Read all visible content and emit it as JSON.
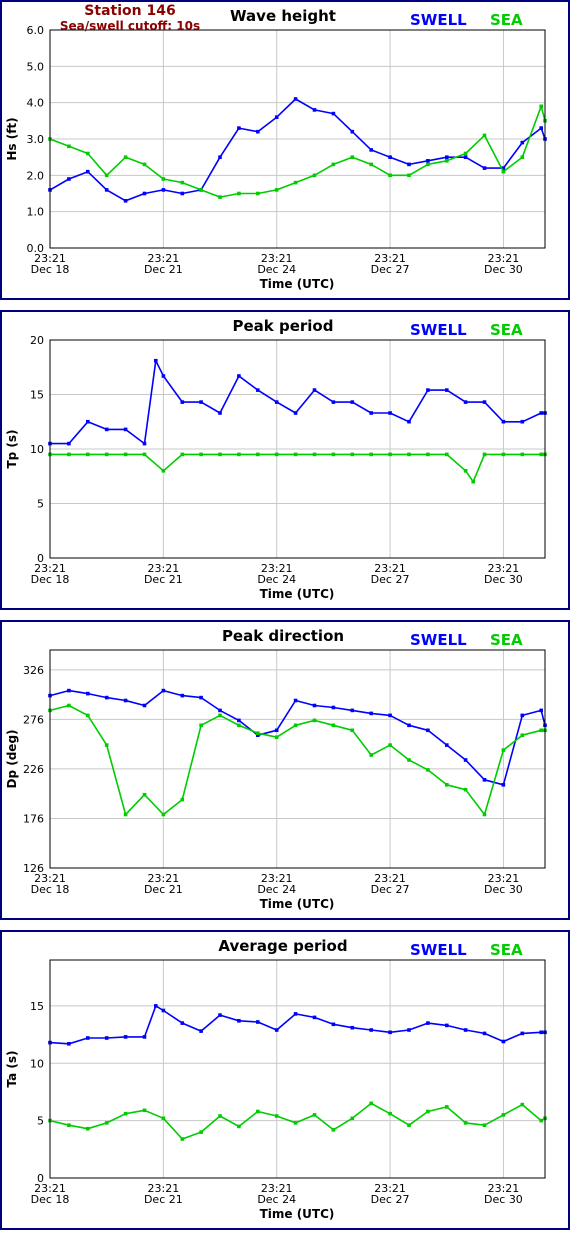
{
  "header": {
    "station": "Station 146",
    "cutoff": "Sea/swell cutoff: 10s"
  },
  "legend": {
    "swell": "SWELL",
    "sea": "SEA"
  },
  "colors": {
    "swell": "#0000ff",
    "sea": "#00cc00",
    "frame": "#00007f",
    "header": "#8b0000"
  },
  "chart_data": [
    {
      "type": "line",
      "title": "Wave height",
      "xlabel": "Time (UTC)",
      "ylabel": "Hs (ft)",
      "ylim": [
        0,
        6
      ],
      "yticks": [
        "0.0",
        "1.0",
        "2.0",
        "3.0",
        "4.0",
        "5.0",
        "6.0"
      ],
      "xlim": [
        0,
        13.1
      ],
      "xticks": [
        {
          "x": 0,
          "time": "23:21",
          "date": "Dec 18"
        },
        {
          "x": 3,
          "time": "23:21",
          "date": "Dec 21"
        },
        {
          "x": 6,
          "time": "23:21",
          "date": "Dec 24"
        },
        {
          "x": 9,
          "time": "23:21",
          "date": "Dec 27"
        },
        {
          "x": 12,
          "time": "23:21",
          "date": "Dec 30"
        }
      ],
      "grid": true,
      "series": [
        {
          "name": "SWELL",
          "color": "#0000ff",
          "x": [
            0,
            0.5,
            1,
            1.5,
            2,
            2.5,
            3,
            3.5,
            4,
            4.5,
            5,
            5.5,
            6,
            6.5,
            7,
            7.5,
            8,
            8.5,
            9,
            9.5,
            10,
            10.5,
            11,
            11.5,
            12,
            12.5,
            13,
            13.1
          ],
          "y": [
            1.6,
            1.9,
            2.1,
            1.6,
            1.3,
            1.5,
            1.6,
            1.5,
            1.6,
            2.5,
            3.3,
            3.2,
            3.6,
            4.1,
            3.8,
            3.7,
            3.2,
            2.7,
            2.5,
            2.3,
            2.4,
            2.5,
            2.5,
            2.2,
            2.2,
            2.9,
            3.3,
            3.0
          ]
        },
        {
          "name": "SEA",
          "color": "#00cc00",
          "x": [
            0,
            0.5,
            1,
            1.5,
            2,
            2.5,
            3,
            3.5,
            4,
            4.5,
            5,
            5.5,
            6,
            6.5,
            7,
            7.5,
            8,
            8.5,
            9,
            9.5,
            10,
            10.5,
            11,
            11.5,
            12,
            12.5,
            13,
            13.1
          ],
          "y": [
            3.0,
            2.8,
            2.6,
            2.0,
            2.5,
            2.3,
            1.9,
            1.8,
            1.6,
            1.4,
            1.5,
            1.5,
            1.6,
            1.8,
            2.0,
            2.3,
            2.5,
            2.3,
            2.0,
            2.0,
            2.3,
            2.4,
            2.6,
            3.1,
            2.1,
            2.5,
            3.9,
            3.5
          ]
        }
      ]
    },
    {
      "type": "line",
      "title": "Peak period",
      "xlabel": "Time (UTC)",
      "ylabel": "Tp (s)",
      "ylim": [
        0,
        20
      ],
      "yticks": [
        "0",
        "5",
        "10",
        "15",
        "20"
      ],
      "xlim": [
        0,
        13.1
      ],
      "xticks": [
        {
          "x": 0,
          "time": "23:21",
          "date": "Dec 18"
        },
        {
          "x": 3,
          "time": "23:21",
          "date": "Dec 21"
        },
        {
          "x": 6,
          "time": "23:21",
          "date": "Dec 24"
        },
        {
          "x": 9,
          "time": "23:21",
          "date": "Dec 27"
        },
        {
          "x": 12,
          "time": "23:21",
          "date": "Dec 30"
        }
      ],
      "grid": true,
      "series": [
        {
          "name": "SWELL",
          "color": "#0000ff",
          "x": [
            0,
            0.5,
            1,
            1.5,
            2,
            2.5,
            2.8,
            3,
            3.5,
            4,
            4.5,
            5,
            5.5,
            6,
            6.5,
            7,
            7.5,
            8,
            8.5,
            9,
            9.5,
            10,
            10.5,
            11,
            11.5,
            12,
            12.5,
            13,
            13.1
          ],
          "y": [
            10.5,
            10.5,
            12.5,
            11.8,
            11.8,
            10.5,
            18.1,
            16.7,
            14.3,
            14.3,
            13.3,
            16.7,
            15.4,
            14.3,
            13.3,
            15.4,
            14.3,
            14.3,
            13.3,
            13.3,
            12.5,
            15.4,
            15.4,
            14.3,
            14.3,
            12.5,
            12.5,
            13.3,
            13.3
          ]
        },
        {
          "name": "SEA",
          "color": "#00cc00",
          "x": [
            0,
            0.5,
            1,
            1.5,
            2,
            2.5,
            3,
            3.5,
            4,
            4.5,
            5,
            5.5,
            6,
            6.5,
            7,
            7.5,
            8,
            8.5,
            9,
            9.5,
            10,
            10.5,
            11,
            11.2,
            11.5,
            12,
            12.5,
            13,
            13.1
          ],
          "y": [
            9.5,
            9.5,
            9.5,
            9.5,
            9.5,
            9.5,
            8.0,
            9.5,
            9.5,
            9.5,
            9.5,
            9.5,
            9.5,
            9.5,
            9.5,
            9.5,
            9.5,
            9.5,
            9.5,
            9.5,
            9.5,
            9.5,
            8.0,
            7.0,
            9.5,
            9.5,
            9.5,
            9.5,
            9.5
          ]
        }
      ]
    },
    {
      "type": "line",
      "title": "Peak direction",
      "xlabel": "Time (UTC)",
      "ylabel": "Dp (deg)",
      "ylim": [
        126,
        346
      ],
      "yticks": [
        "126",
        "176",
        "226",
        "276",
        "326"
      ],
      "xlim": [
        0,
        13.1
      ],
      "xticks": [
        {
          "x": 0,
          "time": "23:21",
          "date": "Dec 18"
        },
        {
          "x": 3,
          "time": "23:21",
          "date": "Dec 21"
        },
        {
          "x": 6,
          "time": "23:21",
          "date": "Dec 24"
        },
        {
          "x": 9,
          "time": "23:21",
          "date": "Dec 27"
        },
        {
          "x": 12,
          "time": "23:21",
          "date": "Dec 30"
        }
      ],
      "grid": true,
      "series": [
        {
          "name": "SWELL",
          "color": "#0000ff",
          "x": [
            0,
            0.5,
            1,
            1.5,
            2,
            2.5,
            3,
            3.5,
            4,
            4.5,
            5,
            5.5,
            6,
            6.5,
            7,
            7.5,
            8,
            8.5,
            9,
            9.5,
            10,
            10.5,
            11,
            11.5,
            12,
            12.5,
            13,
            13.1
          ],
          "y": [
            300,
            305,
            302,
            298,
            295,
            290,
            305,
            300,
            298,
            285,
            275,
            260,
            265,
            295,
            290,
            288,
            285,
            282,
            280,
            270,
            265,
            250,
            235,
            215,
            210,
            280,
            285,
            270
          ]
        },
        {
          "name": "SEA",
          "color": "#00cc00",
          "x": [
            0,
            0.5,
            1,
            1.5,
            2,
            2.5,
            3,
            3.5,
            4,
            4.5,
            5,
            5.5,
            6,
            6.5,
            7,
            7.5,
            8,
            8.5,
            9,
            9.5,
            10,
            10.5,
            11,
            11.5,
            12,
            12.5,
            13,
            13.1
          ],
          "y": [
            285,
            290,
            280,
            250,
            180,
            200,
            180,
            195,
            270,
            280,
            270,
            262,
            258,
            270,
            275,
            270,
            265,
            240,
            250,
            235,
            225,
            210,
            205,
            180,
            245,
            260,
            265,
            265
          ]
        }
      ]
    },
    {
      "type": "line",
      "title": "Average period",
      "xlabel": "Time (UTC)",
      "ylabel": "Ta (s)",
      "ylim": [
        0,
        19
      ],
      "yticks": [
        "0",
        "5",
        "10",
        "15"
      ],
      "xlim": [
        0,
        13.1
      ],
      "xticks": [
        {
          "x": 0,
          "time": "23:21",
          "date": "Dec 18"
        },
        {
          "x": 3,
          "time": "23:21",
          "date": "Dec 21"
        },
        {
          "x": 6,
          "time": "23:21",
          "date": "Dec 24"
        },
        {
          "x": 9,
          "time": "23:21",
          "date": "Dec 27"
        },
        {
          "x": 12,
          "time": "23:21",
          "date": "Dec 30"
        }
      ],
      "grid": true,
      "series": [
        {
          "name": "SWELL",
          "color": "#0000ff",
          "x": [
            0,
            0.5,
            1,
            1.5,
            2,
            2.5,
            2.8,
            3,
            3.5,
            4,
            4.5,
            5,
            5.5,
            6,
            6.5,
            7,
            7.5,
            8,
            8.5,
            9,
            9.5,
            10,
            10.5,
            11,
            11.5,
            12,
            12.5,
            13,
            13.1
          ],
          "y": [
            11.8,
            11.7,
            12.2,
            12.2,
            12.3,
            12.3,
            15.0,
            14.6,
            13.5,
            12.8,
            14.2,
            13.7,
            13.6,
            12.9,
            14.3,
            14.0,
            13.4,
            13.1,
            12.9,
            12.7,
            12.9,
            13.5,
            13.3,
            12.9,
            12.6,
            11.9,
            12.6,
            12.7,
            12.7
          ]
        },
        {
          "name": "SEA",
          "color": "#00cc00",
          "x": [
            0,
            0.5,
            1,
            1.5,
            2,
            2.5,
            3,
            3.5,
            4,
            4.5,
            5,
            5.5,
            6,
            6.5,
            7,
            7.5,
            8,
            8.5,
            9,
            9.5,
            10,
            10.5,
            11,
            11.5,
            12,
            12.5,
            13,
            13.1
          ],
          "y": [
            5.0,
            4.6,
            4.3,
            4.8,
            5.6,
            5.9,
            5.2,
            3.4,
            4.0,
            5.4,
            4.5,
            5.8,
            5.4,
            4.8,
            5.5,
            4.2,
            5.2,
            6.5,
            5.6,
            4.6,
            5.8,
            6.2,
            4.8,
            4.6,
            5.5,
            6.4,
            5.0,
            5.2
          ]
        }
      ]
    }
  ]
}
